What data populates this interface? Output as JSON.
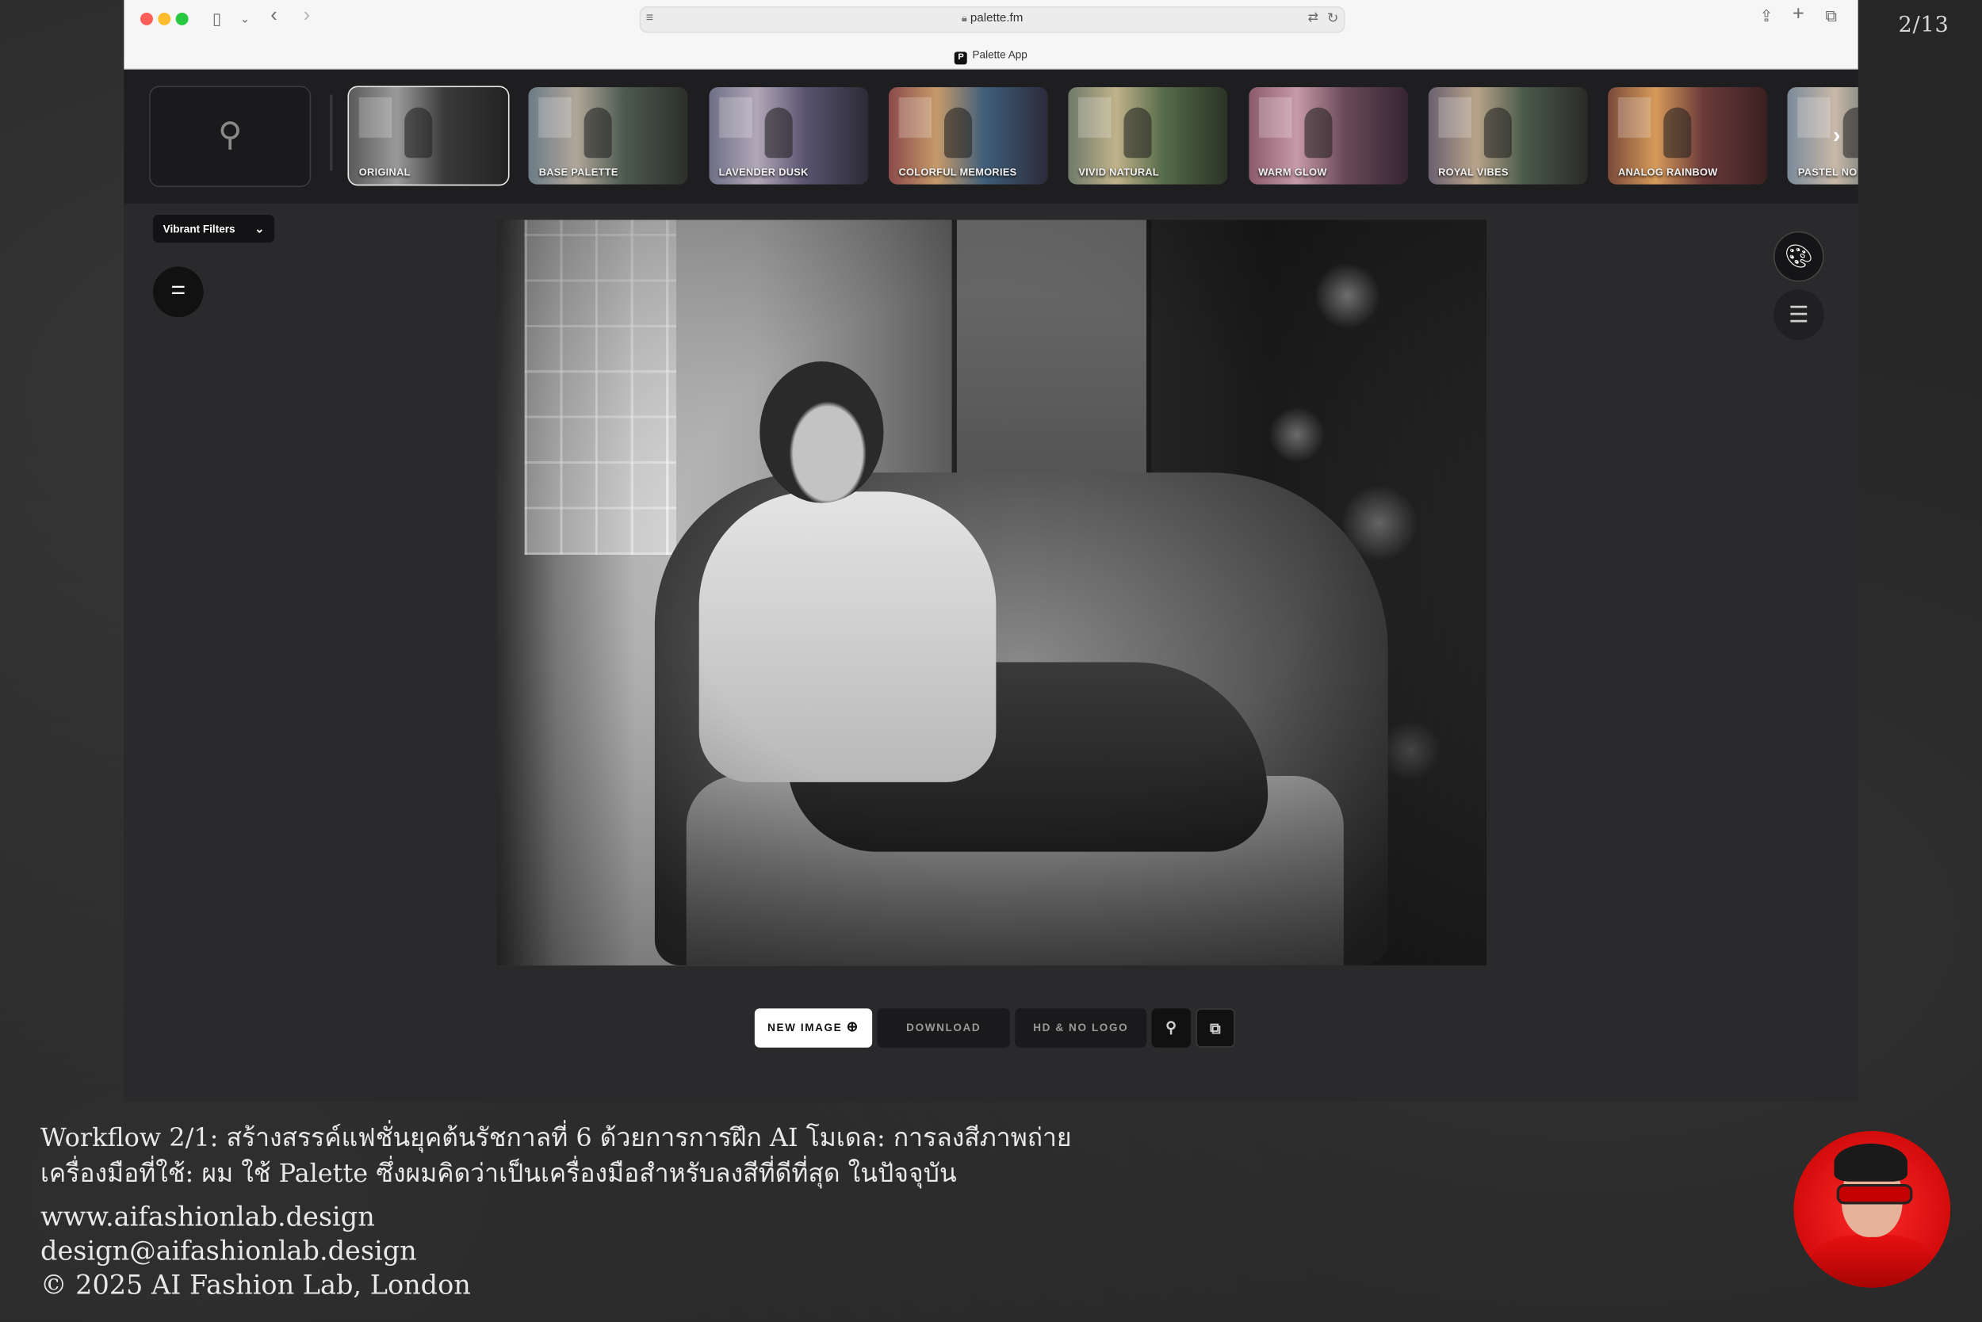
{
  "slide_counter": "2/13",
  "browser": {
    "url": "palette.fm",
    "tab_title": "Palette App",
    "favicon_letter": "P"
  },
  "filters": {
    "items": [
      {
        "label": "ORIGINAL",
        "selected": true
      },
      {
        "label": "BASE PALETTE"
      },
      {
        "label": "LAVENDER DUSK"
      },
      {
        "label": "COLORFUL MEMORIES"
      },
      {
        "label": "VIVID NATURAL"
      },
      {
        "label": "WARM GLOW"
      },
      {
        "label": "ROYAL VIBES"
      },
      {
        "label": "ANALOG RAINBOW"
      },
      {
        "label": "PASTEL NO"
      }
    ]
  },
  "toolbar": {
    "dropdown_label": "Vibrant Filters"
  },
  "actions": {
    "new_image": "NEW IMAGE",
    "download": "DOWNLOAD",
    "hd": "HD & NO LOGO"
  },
  "caption": {
    "line1": "Workflow 2/1: สร้างสรรค์แฟชั่นยุคต้นรัชกาลที่ 6 ด้วยการการฝึก AI โมเดล: การลงสีภาพถ่าย",
    "line2": "เครื่องมือที่ใช้: ผม ใช้ Palette ซึ่งผมคิดว่าเป็นเครื่องมือสำหรับลงสีที่ดีที่สุด ในปัจจุบัน"
  },
  "links": {
    "website": "www.aifashionlab.design",
    "email": "design@aifashionlab.design",
    "copyright": "© 2025 AI Fashion Lab, London"
  }
}
